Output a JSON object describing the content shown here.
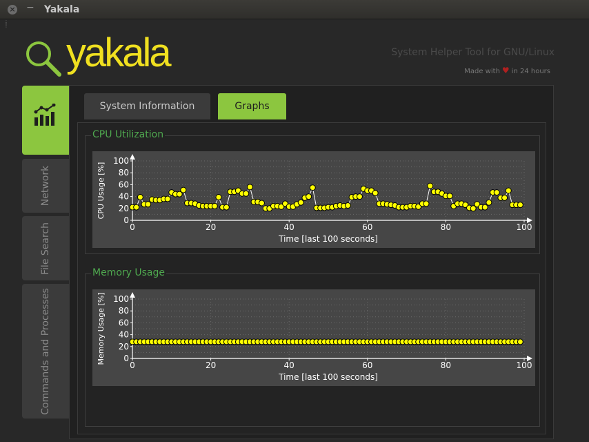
{
  "window": {
    "title": "Yakala",
    "close_glyph": "×",
    "minimize_glyph": "−"
  },
  "header": {
    "logo_icon": "magnifier-icon",
    "logo_text": "yakala",
    "tagline": "System Helper Tool for GNU/Linux",
    "made_with_prefix": "Made with",
    "made_with_suffix": "in 24 hours",
    "heart_icon": "heart-icon"
  },
  "sidebar": {
    "items": [
      {
        "label": "",
        "icon": "graph-icon",
        "active": true
      },
      {
        "label": "Network",
        "active": false
      },
      {
        "label": "File Search",
        "active": false
      },
      {
        "label": "Commands and Processes",
        "active": false
      }
    ]
  },
  "tabs": [
    {
      "label": "System Information",
      "active": false
    },
    {
      "label": "Graphs",
      "active": true
    }
  ],
  "colors": {
    "accent": "#8cc63f",
    "logo": "#f0e020",
    "group_title": "#4fa84f",
    "point": "#ffff00",
    "plot_bg": "#464646"
  },
  "cpu_group": {
    "title": "CPU Utilization"
  },
  "mem_group": {
    "title": "Memory Usage"
  },
  "chart_data": [
    {
      "type": "line",
      "title": "CPU Utilization",
      "xlabel": "Time [last 100 seconds]",
      "ylabel": "CPU Usage [%]",
      "xlim": [
        0,
        100
      ],
      "ylim": [
        0,
        100
      ],
      "xticks": [
        "0",
        "20",
        "40",
        "60",
        "80",
        "100"
      ],
      "yticks": [
        "0",
        "20",
        "40",
        "60",
        "80",
        "100"
      ],
      "grid": true,
      "x": [
        0,
        1,
        2,
        3,
        4,
        5,
        6,
        7,
        8,
        9,
        10,
        11,
        12,
        13,
        14,
        15,
        16,
        17,
        18,
        19,
        20,
        21,
        22,
        23,
        24,
        25,
        26,
        27,
        28,
        29,
        30,
        31,
        32,
        33,
        34,
        35,
        36,
        37,
        38,
        39,
        40,
        41,
        42,
        43,
        44,
        45,
        46,
        47,
        48,
        49,
        50,
        51,
        52,
        53,
        54,
        55,
        56,
        57,
        58,
        59,
        60,
        61,
        62,
        63,
        64,
        65,
        66,
        67,
        68,
        69,
        70,
        71,
        72,
        73,
        74,
        75,
        76,
        77,
        78,
        79,
        80,
        81,
        82,
        83,
        84,
        85,
        86,
        87,
        88,
        89,
        90,
        91,
        92,
        93,
        94,
        95,
        96,
        97,
        98,
        99
      ],
      "series": [
        {
          "values": [
            22,
            22,
            39,
            27,
            27,
            35,
            34,
            34,
            36,
            36,
            47,
            44,
            44,
            51,
            29,
            29,
            28,
            25,
            24,
            24,
            24,
            24,
            39,
            22,
            22,
            48,
            48,
            50,
            45,
            45,
            56,
            31,
            31,
            29,
            20,
            20,
            24,
            24,
            23,
            28,
            23,
            23,
            27,
            30,
            38,
            40,
            55,
            21,
            21,
            21,
            22,
            22,
            24,
            25,
            24,
            25,
            39,
            40,
            40,
            53,
            50,
            50,
            46,
            28,
            28,
            27,
            26,
            25,
            22,
            22,
            22,
            24,
            24,
            23,
            28,
            28,
            58,
            48,
            48,
            45,
            41,
            41,
            24,
            28,
            28,
            26,
            21,
            20,
            27,
            22,
            22,
            30,
            47,
            47,
            38,
            38,
            50,
            26,
            26,
            26
          ]
        }
      ]
    },
    {
      "type": "line",
      "title": "Memory Usage",
      "xlabel": "Time [last 100 seconds]",
      "ylabel": "Memory Usage [%]",
      "xlim": [
        0,
        100
      ],
      "ylim": [
        0,
        100
      ],
      "xticks": [
        "0",
        "20",
        "40",
        "60",
        "80",
        "100"
      ],
      "yticks": [
        "0",
        "20",
        "40",
        "60",
        "80",
        "100"
      ],
      "grid": true,
      "x": [
        0,
        1,
        2,
        3,
        4,
        5,
        6,
        7,
        8,
        9,
        10,
        11,
        12,
        13,
        14,
        15,
        16,
        17,
        18,
        19,
        20,
        21,
        22,
        23,
        24,
        25,
        26,
        27,
        28,
        29,
        30,
        31,
        32,
        33,
        34,
        35,
        36,
        37,
        38,
        39,
        40,
        41,
        42,
        43,
        44,
        45,
        46,
        47,
        48,
        49,
        50,
        51,
        52,
        53,
        54,
        55,
        56,
        57,
        58,
        59,
        60,
        61,
        62,
        63,
        64,
        65,
        66,
        67,
        68,
        69,
        70,
        71,
        72,
        73,
        74,
        75,
        76,
        77,
        78,
        79,
        80,
        81,
        82,
        83,
        84,
        85,
        86,
        87,
        88,
        89,
        90,
        91,
        92,
        93,
        94,
        95,
        96,
        97,
        98,
        99
      ],
      "series": [
        {
          "values": [
            28,
            28,
            28,
            28,
            28,
            28,
            28,
            28,
            28,
            28,
            28,
            28,
            28,
            28,
            28,
            28,
            28,
            28,
            28,
            28,
            28,
            28,
            28,
            28,
            28,
            28,
            28,
            28,
            28,
            28,
            28,
            28,
            28,
            28,
            28,
            28,
            28,
            28,
            28,
            28,
            28,
            28,
            28,
            28,
            28,
            28,
            28,
            28,
            28,
            28,
            28,
            28,
            28,
            28,
            28,
            28,
            28,
            28,
            28,
            28,
            28,
            28,
            28,
            28,
            28,
            28,
            28,
            28,
            28,
            28,
            28,
            28,
            28,
            28,
            28,
            28,
            28,
            28,
            28,
            28,
            28,
            28,
            28,
            28,
            28,
            28,
            28,
            28,
            28,
            28,
            28,
            28,
            28,
            28,
            28,
            28,
            28,
            28,
            28,
            28
          ]
        }
      ]
    }
  ]
}
